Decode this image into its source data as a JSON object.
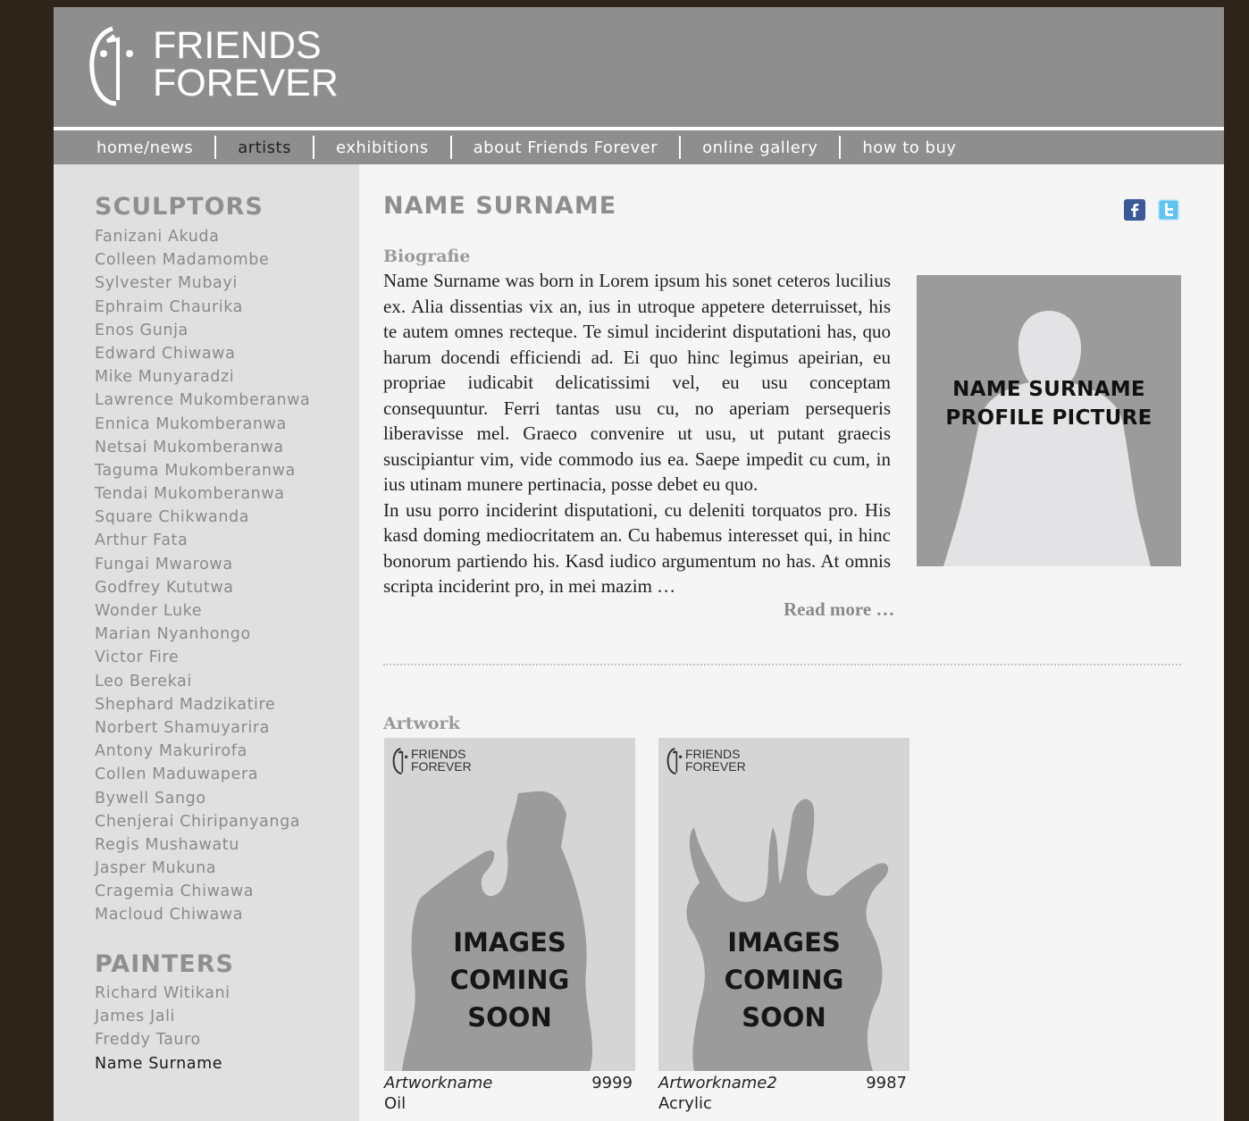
{
  "brand": {
    "line1": "FRIENDS",
    "line2": "FOREVER"
  },
  "nav": [
    {
      "label": "home/news",
      "active": false
    },
    {
      "label": "artists",
      "active": true
    },
    {
      "label": "exhibitions",
      "active": false
    },
    {
      "label": "about Friends Forever",
      "active": false
    },
    {
      "label": "online gallery",
      "active": false
    },
    {
      "label": "how to buy",
      "active": false
    }
  ],
  "sidebar": {
    "sculptors_heading": "SCULPTORS",
    "sculptors": [
      "Fanizani Akuda",
      "Colleen Madamombe",
      "Sylvester Mubayi",
      "Ephraim Chaurika",
      "Enos Gunja",
      "Edward Chiwawa",
      "Mike Munyaradzi",
      "Lawrence Mukomberanwa",
      "Ennica Mukomberanwa",
      "Netsai Mukomberanwa",
      "Taguma Mukomberanwa",
      "Tendai Mukomberanwa",
      "Square Chikwanda",
      "Arthur Fata",
      "Fungai Mwarowa",
      "Godfrey Kututwa",
      "Wonder Luke",
      "Marian Nyanhongo",
      "Victor Fire",
      "Leo Berekai",
      "Shephard Madzikatire",
      "Norbert Shamuyarira",
      "Antony Makurirofa",
      "Collen Maduwapera",
      "Bywell Sango",
      "Chenjerai Chiripanyanga",
      "Regis Mushawatu",
      "Jasper Mukuna",
      "Cragemia Chiwawa",
      "Macloud Chiwawa"
    ],
    "painters_heading": "PAINTERS",
    "painters": [
      "Richard Witikani",
      "James Jali",
      "Freddy Tauro",
      "Name Surname"
    ],
    "current": "Name Surname"
  },
  "main": {
    "title": "NAME SURNAME",
    "biography_label": "Biografie",
    "bio_p1": "Name Surname was born in Lorem ipsum his sonet ceteros lucilius ex. Alia dissentias vix an, ius in utroque appetere deterruisset, his te autem omnes recteque. Te simul inciderint disputationi has, quo harum docendi efficiendi ad. Ei quo hinc legimus apeirian, eu propriae iudicabit delicatissimi vel, eu usu conceptam consequuntur. Ferri tantas usu cu, no aperiam persequeris liberavisse mel. Graeco convenire ut usu, ut putant graecis suscipiantur vim, vide commodo ius ea. Saepe impedit cu cum, in ius utinam munere pertinacia, posse debet eu quo.",
    "bio_p2": "In usu porro inciderint disputationi, cu deleniti torquatos pro. His kasd doming mediocritatem an. Cu habemus interesset qui, in hinc bonorum partiendo his. Kasd iudico argumentum no has. At omnis scripta inciderint pro, in mei mazim …",
    "read_more": "Read more …",
    "profile_caption_line1": "NAME SURNAME",
    "profile_caption_line2": "PROFILE PICTURE",
    "artwork_label": "Artwork",
    "artworks": [
      {
        "name": "Artworkname",
        "number": "9999",
        "medium": "Oil",
        "logo_line1": "FRIENDS",
        "logo_line2": "FOREVER",
        "caption_line1": "IMAGES",
        "caption_line2": "COMING",
        "caption_line3": "SOON"
      },
      {
        "name": "Artworkname2",
        "number": "9987",
        "medium": "Acrylic",
        "logo_line1": "FRIENDS",
        "logo_line2": "FOREVER",
        "caption_line1": "IMAGES",
        "caption_line2": "COMING",
        "caption_line3": "SOON"
      }
    ]
  },
  "social": [
    {
      "icon": "facebook-icon",
      "color": "#3b5998"
    },
    {
      "icon": "twitter-icon",
      "color": "#5ec4f0"
    }
  ],
  "colors": {
    "outer": "#2e2419",
    "header": "#8e8e8e",
    "sidebar": "#e0e0e0",
    "content": "#f5f5f5",
    "placeholder_art": "#d5d5d6",
    "placeholder_shape": "#9b9b9b"
  }
}
